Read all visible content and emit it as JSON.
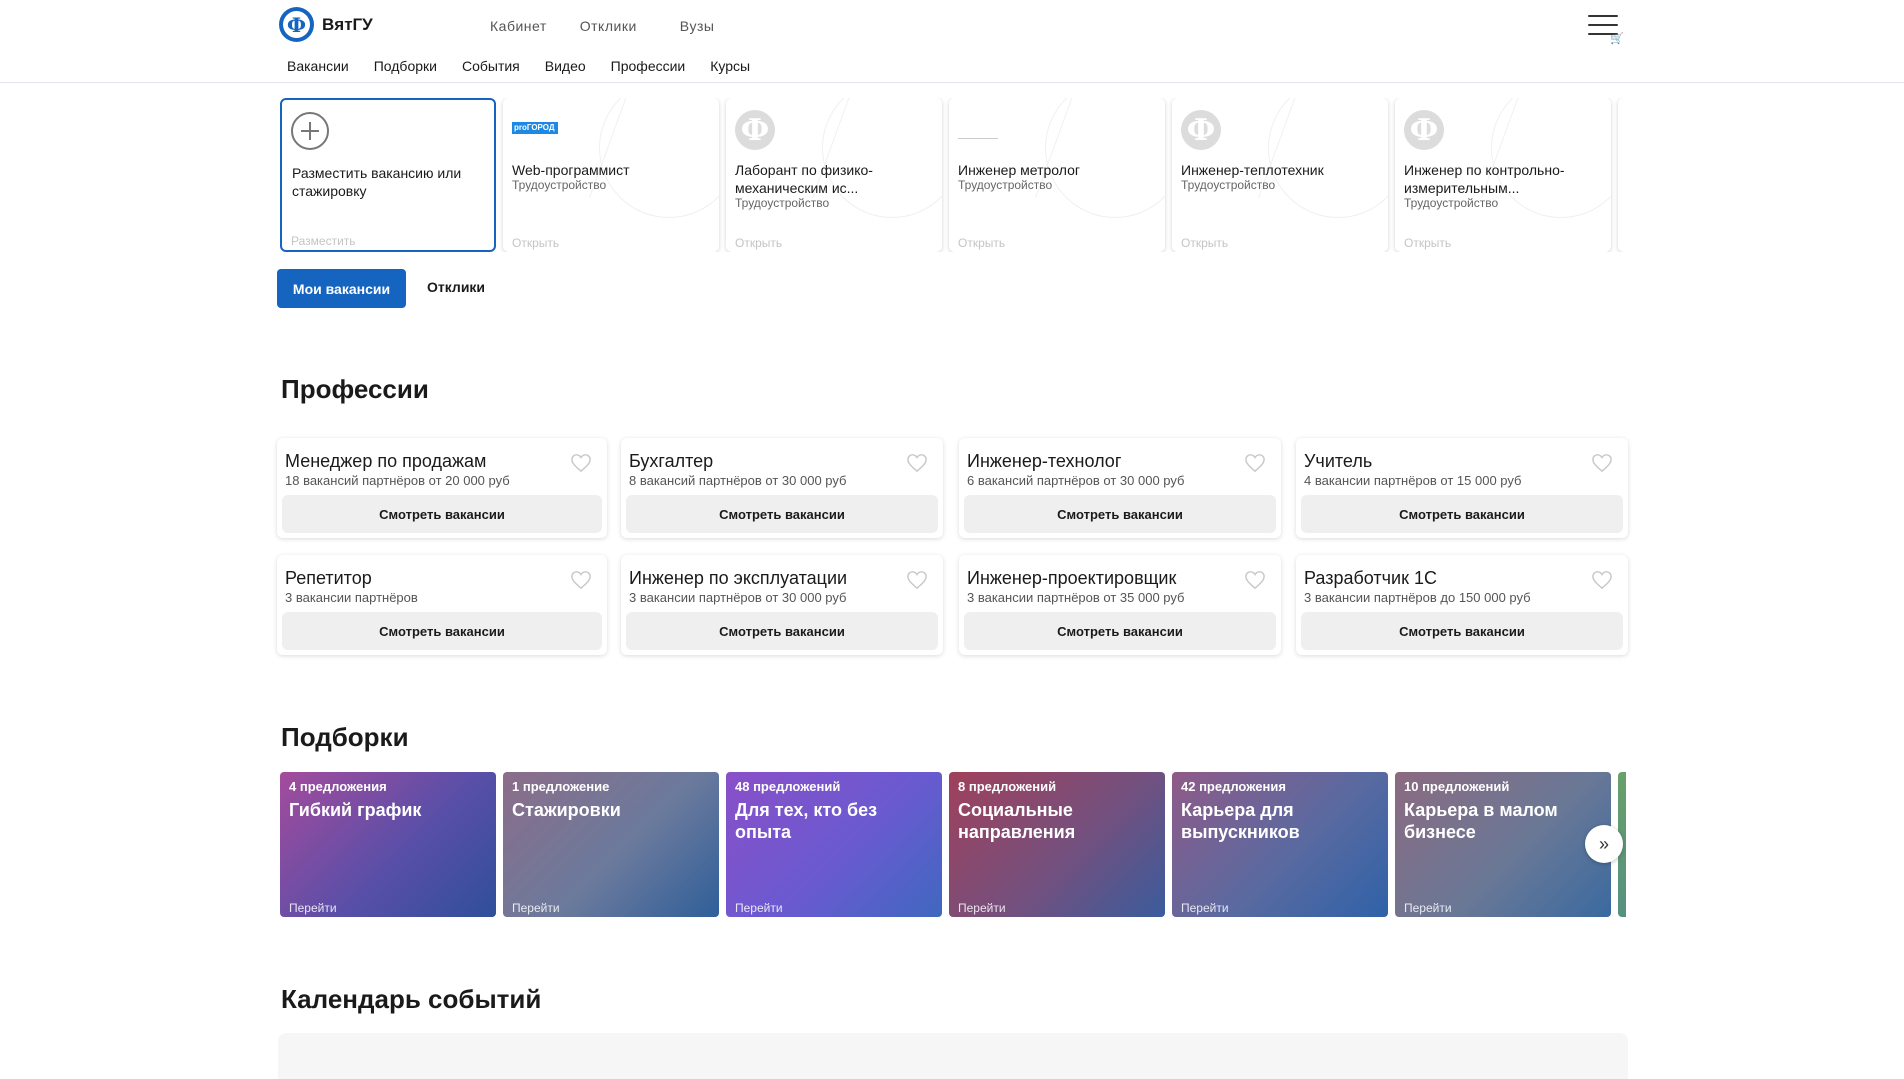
{
  "header": {
    "logo_text": "ВятГУ",
    "top_nav": [
      "Кабинет",
      "Отклики",
      "Вузы"
    ],
    "sub_nav": [
      "Вакансии",
      "Подборки",
      "События",
      "Видео",
      "Профессии",
      "Курсы"
    ]
  },
  "vacancies": {
    "add_card": {
      "title": "Разместить вакансию или стажировку",
      "action": "Разместить"
    },
    "items": [
      {
        "title": "Web-программист",
        "type": "Трудоустройство",
        "action": "Открыть",
        "logo": "progorod-logo",
        "logo_text": "proГОРОД"
      },
      {
        "title": "Лаборант по физико-механическим ис...",
        "type": "Трудоустройство",
        "action": "Открыть",
        "logo": "placeholder-logo"
      },
      {
        "title": "Инженер метролог",
        "type": "Трудоустройство",
        "action": "Открыть",
        "logo": "line-logo"
      },
      {
        "title": "Инженер-теплотехник",
        "type": "Трудоустройство",
        "action": "Открыть",
        "logo": "placeholder-logo"
      },
      {
        "title": "Инженер по контрольно-измерительным...",
        "type": "Трудоустройство",
        "action": "Открыть",
        "logo": "placeholder-logo"
      }
    ]
  },
  "tabs": {
    "my_vacancies": "Мои вакансии",
    "responses": "Отклики"
  },
  "professions": {
    "heading": "Профессии",
    "button_label": "Смотреть вакансии",
    "items": [
      {
        "title": "Менеджер по продажам",
        "subtitle": "18 вакансий партнёров от 20 000 руб"
      },
      {
        "title": "Бухгалтер",
        "subtitle": "8 вакансий партнёров от 30 000 руб"
      },
      {
        "title": "Инженер-технолог",
        "subtitle": "6 вакансий партнёров от 30 000 руб"
      },
      {
        "title": "Учитель",
        "subtitle": "4 вакансии партнёров от 15 000 руб"
      },
      {
        "title": "Репетитор",
        "subtitle": "3 вакансии партнёров"
      },
      {
        "title": "Инженер по эксплуатации",
        "subtitle": "3 вакансии партнёров от 30 000 руб"
      },
      {
        "title": "Инженер-проектировщик",
        "subtitle": "3 вакансии партнёров от 35 000 руб"
      },
      {
        "title": "Разработчик 1С",
        "subtitle": "3 вакансии партнёров до 150 000 руб"
      }
    ]
  },
  "collections": {
    "heading": "Подборки",
    "go_label": "Перейти",
    "items": [
      {
        "count": "4 предложения",
        "title": "Гибкий график",
        "colors": [
          "#a44b9c",
          "#5a4fa8",
          "#2f4f9a"
        ]
      },
      {
        "count": "1 предложение",
        "title": "Стажировки",
        "colors": [
          "#8c6d8a",
          "#6b7a9c",
          "#2f5f9a"
        ]
      },
      {
        "count": "48 предложений",
        "title": "Для тех, кто без опыта",
        "colors": [
          "#8a4fc8",
          "#6a5ad0",
          "#3f68c0"
        ]
      },
      {
        "count": "8 предложений",
        "title": "Социальные направления",
        "colors": [
          "#a0405a",
          "#74507e",
          "#3a5c9c"
        ]
      },
      {
        "count": "42 предложения",
        "title": "Карьера для выпускников",
        "colors": [
          "#8f5a88",
          "#5a6aa0",
          "#2f62a8"
        ]
      },
      {
        "count": "10 предложений",
        "title": "Карьера в малом бизнесе",
        "colors": [
          "#8b6a80",
          "#6a7896",
          "#3a6aa0"
        ]
      }
    ]
  },
  "calendar": {
    "heading": "Календарь событий"
  },
  "colors": {
    "primary": "#1565c0"
  }
}
